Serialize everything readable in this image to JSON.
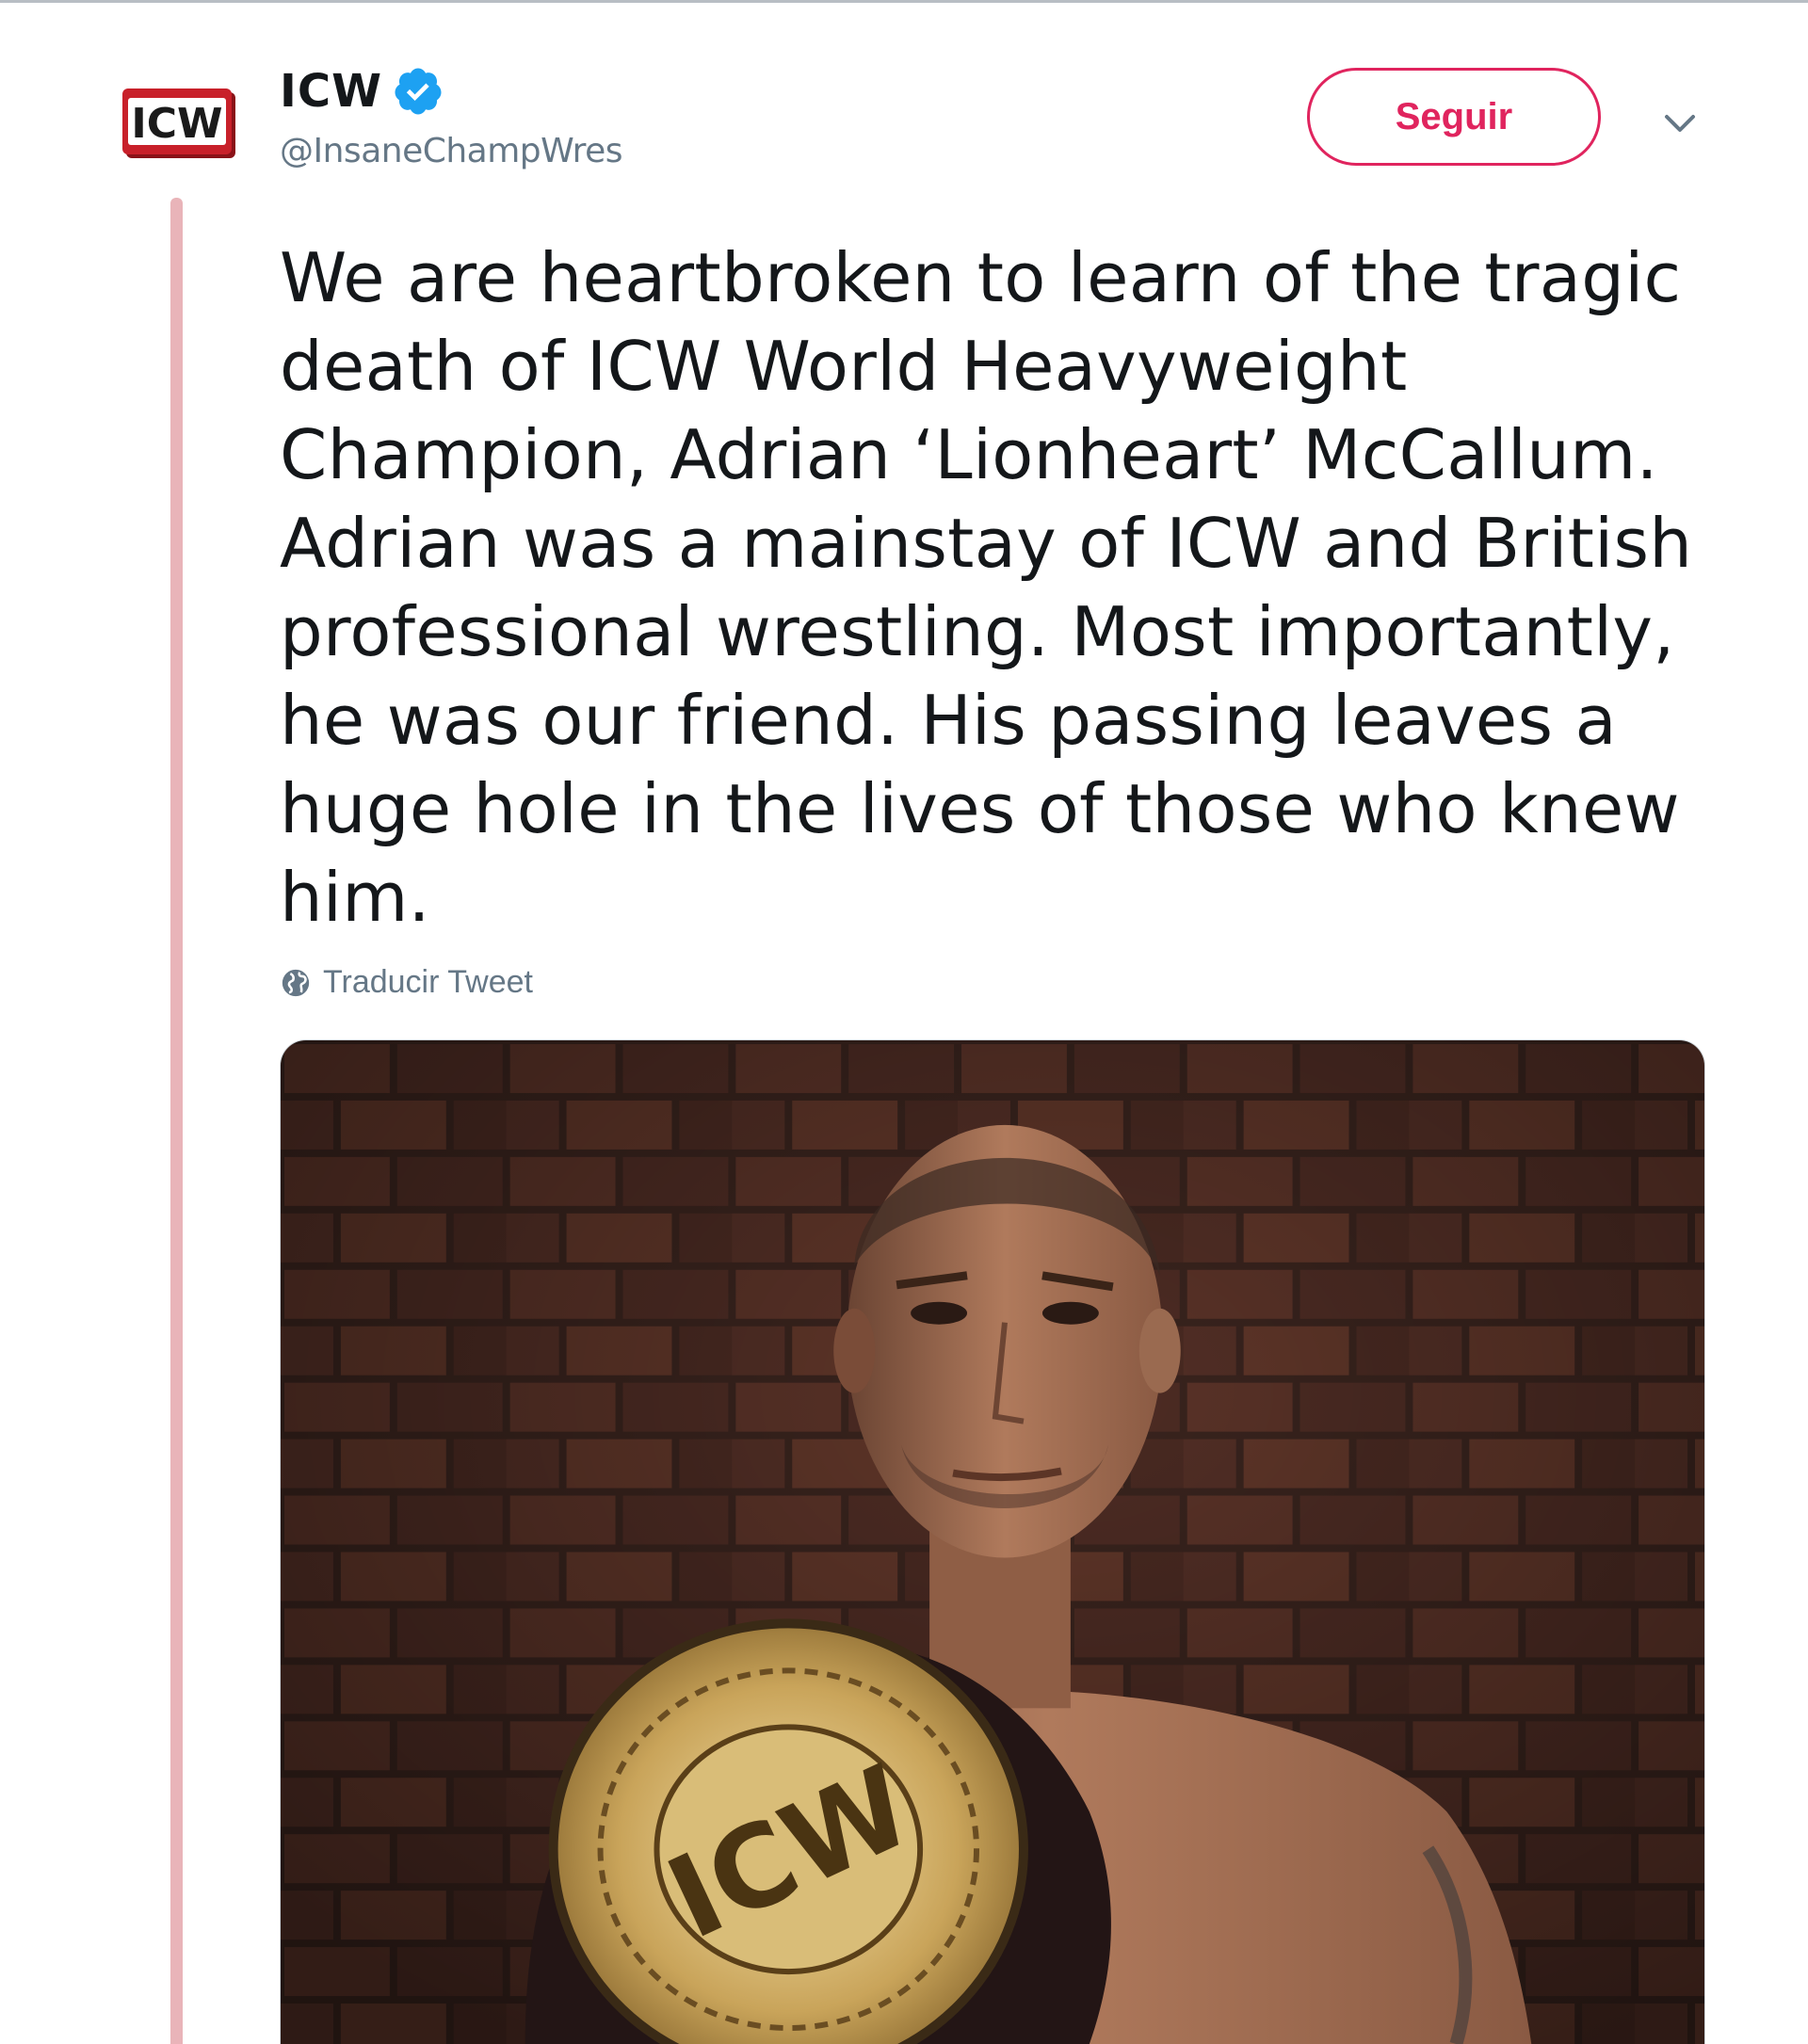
{
  "tweet": {
    "author": {
      "display_name": "ICW",
      "handle": "@InsaneChampWres",
      "verified": true,
      "avatar_icon": "icw-logo-icon",
      "avatar_text": "ICW"
    },
    "follow_label": "Seguir",
    "menu_icon": "chevron-down-icon",
    "text": "We are heartbroken to learn of the tragic death of ICW World Heavyweight Champion, Adrian ‘Lionheart’ McCallum. Adrian was a mainstay of ICW and British professional wrestling. Most importantly, he was our friend. His passing leaves a huge hole in the lives of those who knew him.",
    "translate_label": "Traducir Tweet",
    "translate_icon": "globe-icon",
    "media": {
      "type": "photo",
      "description_icon": "wrestler-with-championship-belt-photo",
      "belt_text": "ICW"
    }
  },
  "colors": {
    "follow_accent": "#e0245e",
    "verified_blue": "#1da1f2",
    "thread_line": "#e9b4b9",
    "secondary_text": "#657786",
    "primary_text": "#14171a",
    "logo_red": "#c8202a"
  }
}
